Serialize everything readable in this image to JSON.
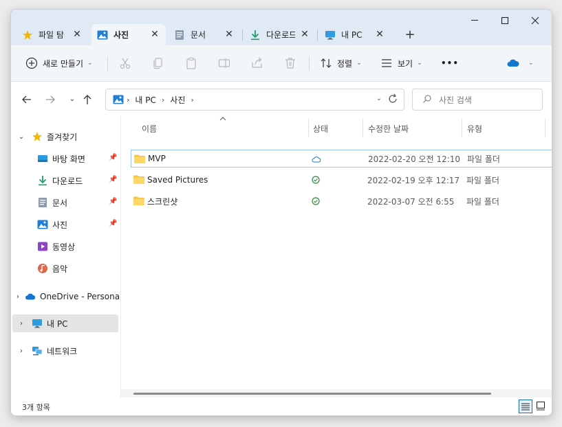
{
  "colors": {
    "accent": "#0f6cbd",
    "tabbar": "#dfeaf5",
    "folder": "#f5c542",
    "synced": "#2b8a3e"
  },
  "tabs": [
    {
      "label": "파일 탐색기",
      "icon": "star-icon",
      "active": false
    },
    {
      "label": "사진",
      "icon": "pictures-icon",
      "active": true
    },
    {
      "label": "문서",
      "icon": "document-icon",
      "active": false
    },
    {
      "label": "다운로드",
      "icon": "download-icon",
      "active": false
    },
    {
      "label": "내 PC",
      "icon": "monitor-icon",
      "active": false
    }
  ],
  "window_controls": {
    "minimize": "—",
    "maximize": "☐",
    "close": "✕"
  },
  "newtab_label": "+",
  "command_bar": {
    "new_label": "새로 만들기",
    "sort_label": "정렬",
    "view_label": "보기",
    "more_label": "•••"
  },
  "address": {
    "crumbs": [
      "내 PC",
      "사진"
    ],
    "separator": "›"
  },
  "search": {
    "placeholder": "사진 검색"
  },
  "sidebar": {
    "quick_access": "즐겨찾기",
    "items": [
      {
        "label": "바탕 화면",
        "icon": "desktop-icon",
        "pinned": true
      },
      {
        "label": "다운로드",
        "icon": "download-icon",
        "pinned": true
      },
      {
        "label": "문서",
        "icon": "document-icon",
        "pinned": true
      },
      {
        "label": "사진",
        "icon": "pictures-icon",
        "pinned": true
      },
      {
        "label": "동영상",
        "icon": "video-icon",
        "pinned": false
      },
      {
        "label": "음악",
        "icon": "music-icon",
        "pinned": false
      }
    ],
    "onedrive": "OneDrive - Persona",
    "this_pc": "내 PC",
    "network": "네트워크"
  },
  "columns": {
    "name": "이름",
    "status": "상태",
    "date": "수정한 날짜",
    "type": "유형"
  },
  "files": [
    {
      "name": "MVP",
      "status": "cloud",
      "date": "2022-02-20 오전 12:10",
      "type": "파일 폴더"
    },
    {
      "name": "Saved Pictures",
      "status": "synced",
      "date": "2022-02-19 오후 12:17",
      "type": "파일 폴더"
    },
    {
      "name": "스크린샷",
      "status": "synced",
      "date": "2022-03-07 오전 6:55",
      "type": "파일 폴더"
    }
  ],
  "status_bar": {
    "count": "3개 항목"
  }
}
